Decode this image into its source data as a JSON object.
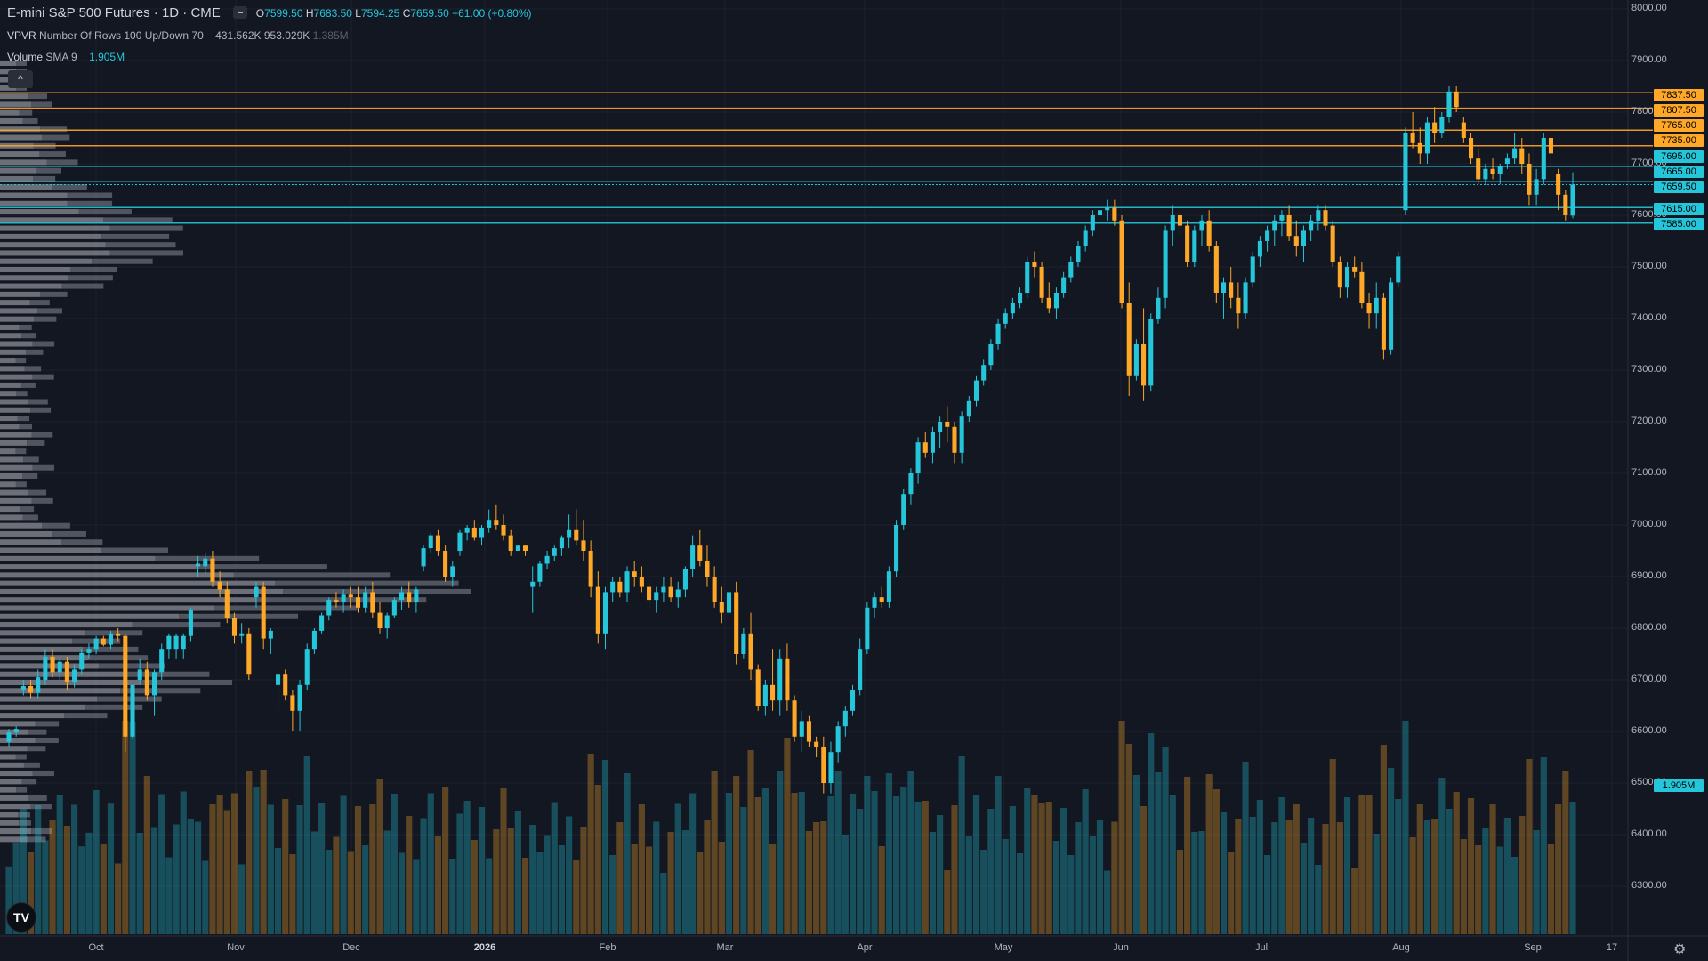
{
  "symbol": {
    "title": "E-mini S&P 500 Futures · 1D · CME",
    "open_label": "O",
    "open": "7599.50",
    "high_label": "H",
    "high": "7683.50",
    "low_label": "L",
    "low": "7594.25",
    "close_label": "C",
    "close": "7659.50",
    "change": "+61.00 (+0.80%)"
  },
  "indicators": {
    "vpvr_name": "VPVR",
    "vpvr_params": "Number Of Rows 100 Up/Down 70",
    "vpvr_values": [
      "431.562K",
      "953.029K",
      "1.385M"
    ],
    "volume_name": "Volume",
    "volume_params": "SMA 9",
    "volume_value": "1.905M"
  },
  "buttons": {
    "collapse": "^"
  },
  "logo": "TV",
  "settings_icon": "⚙",
  "colors": {
    "up": "#26c6da",
    "down": "#ffa726",
    "background": "#131722",
    "profile": "#9e9e9e"
  },
  "price_axis": [
    "8000.00",
    "7900.00",
    "7800.00",
    "7700.00",
    "7600.00",
    "7500.00",
    "7400.00",
    "7300.00",
    "7200.00",
    "7100.00",
    "7000.00",
    "6900.00",
    "6800.00",
    "6700.00",
    "6600.00",
    "6500.00",
    "6400.00",
    "6300.00"
  ],
  "price_tags": [
    {
      "label": "7837.50",
      "type": "down"
    },
    {
      "label": "7807.50",
      "type": "down"
    },
    {
      "label": "7765.00",
      "type": "down"
    },
    {
      "label": "7735.00",
      "type": "down"
    },
    {
      "label": "7695.00",
      "type": "up"
    },
    {
      "label": "7665.00",
      "type": "up"
    },
    {
      "label": "7659.50",
      "type": "up"
    },
    {
      "label": "7615.00",
      "type": "up"
    },
    {
      "label": "7585.00",
      "type": "up"
    }
  ],
  "volume_tag": "1.905M",
  "date_axis": [
    "Oct",
    "Nov",
    "Dec",
    "2026",
    "Feb",
    "Mar",
    "Apr",
    "May",
    "Jun",
    "Jul",
    "Aug",
    "Sep",
    "17"
  ],
  "chart_data": {
    "type": "candlestick",
    "y_range": [
      6250,
      8000
    ],
    "horizontal_levels": [
      {
        "price": 7837.5,
        "color": "down"
      },
      {
        "price": 7807.5,
        "color": "down"
      },
      {
        "price": 7765,
        "color": "down"
      },
      {
        "price": 7735,
        "color": "down"
      },
      {
        "price": 7695,
        "color": "up"
      },
      {
        "price": 7665,
        "color": "up"
      },
      {
        "price": 7615,
        "color": "up"
      },
      {
        "price": 7585,
        "color": "up"
      }
    ],
    "last_price": 7659.5,
    "candles_ohlc": [
      [
        6580,
        6605,
        6570,
        6598
      ],
      [
        6598,
        6610,
        6590,
        6605
      ],
      [
        6680,
        6700,
        6670,
        6688
      ],
      [
        6688,
        6700,
        6665,
        6675
      ],
      [
        6675,
        6720,
        6665,
        6705
      ],
      [
        6700,
        6760,
        6690,
        6745
      ],
      [
        6745,
        6760,
        6705,
        6715
      ],
      [
        6715,
        6745,
        6700,
        6735
      ],
      [
        6735,
        6745,
        6680,
        6695
      ],
      [
        6695,
        6730,
        6685,
        6720
      ],
      [
        6720,
        6760,
        6710,
        6752
      ],
      [
        6752,
        6770,
        6740,
        6760
      ],
      [
        6760,
        6785,
        6750,
        6780
      ],
      [
        6780,
        6785,
        6765,
        6768
      ],
      [
        6768,
        6795,
        6760,
        6790
      ],
      [
        6790,
        6800,
        6775,
        6785
      ],
      [
        6785,
        6790,
        6560,
        6590
      ],
      [
        6590,
        6690,
        6585,
        6690
      ],
      [
        6700,
        6740,
        6690,
        6720
      ],
      [
        6720,
        6735,
        6660,
        6670
      ],
      [
        6670,
        6720,
        6630,
        6715
      ],
      [
        6715,
        6770,
        6700,
        6760
      ],
      [
        6760,
        6790,
        6740,
        6785
      ],
      [
        6760,
        6790,
        6740,
        6785
      ],
      [
        6760,
        6790,
        6740,
        6785
      ],
      [
        6785,
        6840,
        6775,
        6835
      ],
      [
        6920,
        6940,
        6900,
        6925
      ],
      [
        6920,
        6945,
        6905,
        6935
      ],
      [
        6935,
        6950,
        6880,
        6890
      ],
      [
        6890,
        6910,
        6860,
        6875
      ],
      [
        6875,
        6890,
        6810,
        6820
      ],
      [
        6820,
        6830,
        6770,
        6785
      ],
      [
        6785,
        6810,
        6770,
        6790
      ],
      [
        6790,
        6800,
        6700,
        6710
      ],
      [
        6860,
        6890,
        6840,
        6880
      ],
      [
        6880,
        6890,
        6760,
        6780
      ],
      [
        6780,
        6800,
        6750,
        6795
      ],
      [
        6690,
        6720,
        6640,
        6710
      ],
      [
        6710,
        6720,
        6660,
        6670
      ],
      [
        6670,
        6680,
        6600,
        6640
      ],
      [
        6640,
        6700,
        6600,
        6690
      ],
      [
        6690,
        6770,
        6680,
        6760
      ],
      [
        6760,
        6800,
        6750,
        6795
      ],
      [
        6795,
        6830,
        6790,
        6825
      ],
      [
        6825,
        6860,
        6815,
        6855
      ],
      [
        6855,
        6870,
        6840,
        6850
      ],
      [
        6850,
        6875,
        6830,
        6865
      ],
      [
        6865,
        6880,
        6840,
        6860
      ],
      [
        6860,
        6880,
        6830,
        6840
      ],
      [
        6840,
        6880,
        6830,
        6870
      ],
      [
        6870,
        6890,
        6820,
        6830
      ],
      [
        6830,
        6850,
        6790,
        6800
      ],
      [
        6800,
        6830,
        6780,
        6825
      ],
      [
        6825,
        6860,
        6820,
        6855
      ],
      [
        6855,
        6880,
        6835,
        6870
      ],
      [
        6870,
        6890,
        6840,
        6850
      ],
      [
        6850,
        6880,
        6830,
        6875
      ],
      [
        6920,
        6960,
        6910,
        6955
      ],
      [
        6955,
        6985,
        6945,
        6980
      ],
      [
        6980,
        6990,
        6940,
        6950
      ],
      [
        6950,
        6960,
        6890,
        6900
      ],
      [
        6900,
        6930,
        6880,
        6920
      ],
      [
        6950,
        6990,
        6940,
        6985
      ],
      [
        6985,
        7000,
        6970,
        6995
      ],
      [
        6995,
        7010,
        6970,
        6975
      ],
      [
        6975,
        7000,
        6960,
        6995
      ],
      [
        6995,
        7030,
        6985,
        7010
      ],
      [
        7010,
        7040,
        6990,
        7000
      ],
      [
        7000,
        7020,
        6970,
        6980
      ],
      [
        6980,
        6990,
        6940,
        6950
      ],
      [
        6950,
        6960,
        6950,
        6960
      ],
      [
        6960,
        6960,
        6940,
        6950
      ],
      [
        6880,
        6920,
        6830,
        6890
      ],
      [
        6890,
        6930,
        6880,
        6925
      ],
      [
        6925,
        6950,
        6915,
        6940
      ],
      [
        6940,
        6960,
        6930,
        6955
      ],
      [
        6955,
        6980,
        6940,
        6975
      ],
      [
        6975,
        7020,
        6955,
        6990
      ],
      [
        6990,
        7030,
        6960,
        6970
      ],
      [
        6970,
        7010,
        6930,
        6950
      ],
      [
        6950,
        6970,
        6860,
        6880
      ],
      [
        6880,
        6910,
        6770,
        6790
      ],
      [
        6790,
        6880,
        6760,
        6870
      ],
      [
        6870,
        6900,
        6850,
        6890
      ],
      [
        6890,
        6900,
        6860,
        6870
      ],
      [
        6870,
        6920,
        6850,
        6910
      ],
      [
        6910,
        6930,
        6880,
        6900
      ],
      [
        6900,
        6920,
        6870,
        6880
      ],
      [
        6880,
        6890,
        6840,
        6855
      ],
      [
        6855,
        6880,
        6830,
        6870
      ],
      [
        6870,
        6900,
        6850,
        6880
      ],
      [
        6880,
        6900,
        6850,
        6860
      ],
      [
        6860,
        6890,
        6840,
        6875
      ],
      [
        6875,
        6920,
        6860,
        6915
      ],
      [
        6915,
        6980,
        6900,
        6960
      ],
      [
        6960,
        6990,
        6920,
        6930
      ],
      [
        6930,
        6960,
        6880,
        6900
      ],
      [
        6900,
        6920,
        6840,
        6850
      ],
      [
        6850,
        6880,
        6810,
        6830
      ],
      [
        6830,
        6880,
        6810,
        6870
      ],
      [
        6870,
        6890,
        6730,
        6750
      ],
      [
        6750,
        6800,
        6740,
        6790
      ],
      [
        6790,
        6830,
        6700,
        6720
      ],
      [
        6720,
        6730,
        6640,
        6650
      ],
      [
        6650,
        6700,
        6630,
        6690
      ],
      [
        6690,
        6760,
        6640,
        6660
      ],
      [
        6660,
        6760,
        6630,
        6740
      ],
      [
        6740,
        6770,
        6640,
        6660
      ],
      [
        6660,
        6670,
        6580,
        6590
      ],
      [
        6590,
        6640,
        6560,
        6620
      ],
      [
        6620,
        6630,
        6570,
        6580
      ],
      [
        6580,
        6590,
        6550,
        6570
      ],
      [
        6570,
        6590,
        6480,
        6500
      ],
      [
        6500,
        6580,
        6480,
        6560
      ],
      [
        6560,
        6620,
        6540,
        6610
      ],
      [
        6610,
        6650,
        6590,
        6640
      ],
      [
        6640,
        6690,
        6630,
        6680
      ],
      [
        6680,
        6780,
        6670,
        6760
      ],
      [
        6760,
        6850,
        6750,
        6840
      ],
      [
        6840,
        6870,
        6820,
        6860
      ],
      [
        6860,
        6880,
        6840,
        6850
      ],
      [
        6850,
        6920,
        6840,
        6910
      ],
      [
        6910,
        7010,
        6900,
        7000
      ],
      [
        7000,
        7070,
        6990,
        7060
      ],
      [
        7060,
        7110,
        7040,
        7100
      ],
      [
        7100,
        7170,
        7080,
        7160
      ],
      [
        7160,
        7180,
        7130,
        7140
      ],
      [
        7140,
        7190,
        7120,
        7180
      ],
      [
        7180,
        7210,
        7150,
        7200
      ],
      [
        7200,
        7230,
        7160,
        7190
      ],
      [
        7190,
        7200,
        7120,
        7140
      ],
      [
        7140,
        7220,
        7120,
        7210
      ],
      [
        7210,
        7250,
        7200,
        7240
      ],
      [
        7240,
        7290,
        7230,
        7280
      ],
      [
        7280,
        7320,
        7270,
        7310
      ],
      [
        7310,
        7360,
        7300,
        7350
      ],
      [
        7350,
        7400,
        7340,
        7390
      ],
      [
        7390,
        7420,
        7380,
        7410
      ],
      [
        7410,
        7440,
        7400,
        7430
      ],
      [
        7430,
        7460,
        7420,
        7450
      ],
      [
        7450,
        7520,
        7440,
        7510
      ],
      [
        7510,
        7530,
        7480,
        7500
      ],
      [
        7500,
        7510,
        7430,
        7440
      ],
      [
        7440,
        7470,
        7410,
        7420
      ],
      [
        7420,
        7460,
        7400,
        7450
      ],
      [
        7450,
        7490,
        7440,
        7480
      ],
      [
        7480,
        7520,
        7470,
        7510
      ],
      [
        7510,
        7550,
        7500,
        7540
      ],
      [
        7540,
        7580,
        7530,
        7570
      ],
      [
        7570,
        7610,
        7560,
        7600
      ],
      [
        7600,
        7620,
        7580,
        7610
      ],
      [
        7610,
        7630,
        7590,
        7615
      ],
      [
        7615,
        7630,
        7580,
        7590
      ],
      [
        7590,
        7600,
        7420,
        7430
      ],
      [
        7430,
        7470,
        7250,
        7290
      ],
      [
        7290,
        7360,
        7280,
        7350
      ],
      [
        7350,
        7420,
        7240,
        7270
      ],
      [
        7270,
        7410,
        7260,
        7400
      ],
      [
        7400,
        7460,
        7390,
        7440
      ],
      [
        7440,
        7580,
        7420,
        7570
      ],
      [
        7570,
        7620,
        7540,
        7600
      ],
      [
        7600,
        7610,
        7560,
        7580
      ],
      [
        7580,
        7590,
        7500,
        7510
      ],
      [
        7510,
        7580,
        7500,
        7570
      ],
      [
        7570,
        7600,
        7540,
        7590
      ],
      [
        7590,
        7610,
        7530,
        7540
      ],
      [
        7540,
        7550,
        7430,
        7450
      ],
      [
        7450,
        7480,
        7400,
        7470
      ],
      [
        7470,
        7500,
        7420,
        7440
      ],
      [
        7440,
        7470,
        7380,
        7410
      ],
      [
        7410,
        7480,
        7400,
        7470
      ],
      [
        7470,
        7530,
        7460,
        7520
      ],
      [
        7520,
        7560,
        7500,
        7550
      ],
      [
        7550,
        7580,
        7530,
        7570
      ],
      [
        7570,
        7600,
        7540,
        7590
      ],
      [
        7590,
        7610,
        7560,
        7600
      ],
      [
        7600,
        7620,
        7550,
        7560
      ],
      [
        7560,
        7590,
        7520,
        7540
      ],
      [
        7540,
        7580,
        7510,
        7570
      ],
      [
        7570,
        7600,
        7550,
        7590
      ],
      [
        7590,
        7620,
        7570,
        7610
      ],
      [
        7610,
        7620,
        7570,
        7580
      ],
      [
        7580,
        7590,
        7500,
        7510
      ],
      [
        7510,
        7520,
        7440,
        7460
      ],
      [
        7460,
        7510,
        7440,
        7500
      ],
      [
        7500,
        7520,
        7480,
        7490
      ],
      [
        7490,
        7510,
        7420,
        7430
      ],
      [
        7430,
        7450,
        7380,
        7410
      ],
      [
        7410,
        7470,
        7380,
        7440
      ],
      [
        7440,
        7450,
        7320,
        7340
      ],
      [
        7340,
        7480,
        7330,
        7470
      ],
      [
        7470,
        7530,
        7460,
        7520
      ],
      [
        7610,
        7770,
        7600,
        7760
      ],
      [
        7760,
        7800,
        7730,
        7740
      ],
      [
        7740,
        7770,
        7700,
        7720
      ],
      [
        7720,
        7790,
        7700,
        7780
      ],
      [
        7780,
        7810,
        7740,
        7760
      ],
      [
        7760,
        7800,
        7750,
        7790
      ],
      [
        7790,
        7850,
        7780,
        7840
      ],
      [
        7840,
        7850,
        7800,
        7810
      ],
      [
        7780,
        7790,
        7740,
        7750
      ],
      [
        7750,
        7760,
        7700,
        7710
      ],
      [
        7710,
        7730,
        7660,
        7670
      ],
      [
        7670,
        7700,
        7660,
        7690
      ],
      [
        7690,
        7710,
        7670,
        7680
      ],
      [
        7680,
        7700,
        7660,
        7695
      ],
      [
        7700,
        7720,
        7690,
        7710
      ],
      [
        7710,
        7760,
        7700,
        7730
      ],
      [
        7730,
        7750,
        7680,
        7700
      ],
      [
        7700,
        7720,
        7620,
        7640
      ],
      [
        7640,
        7690,
        7620,
        7670
      ],
      [
        7670,
        7760,
        7660,
        7750
      ],
      [
        7750,
        7760,
        7690,
        7720
      ],
      [
        7680,
        7690,
        7610,
        7640
      ],
      [
        7640,
        7650,
        7590,
        7600
      ],
      [
        7599.5,
        7683.5,
        7594.25,
        7659.5
      ]
    ]
  }
}
